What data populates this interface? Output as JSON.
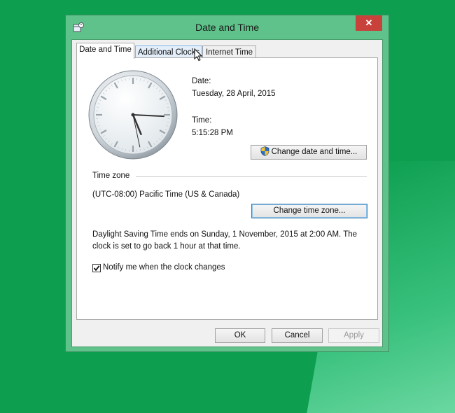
{
  "window": {
    "title": "Date and Time",
    "close_label": "✕"
  },
  "tabs": [
    {
      "label": "Date and Time",
      "active": true
    },
    {
      "label": "Additional Clocks",
      "active": false,
      "hover": true
    },
    {
      "label": "Internet Time",
      "active": false
    }
  ],
  "datetime": {
    "date_label": "Date:",
    "date_value": "Tuesday, 28 April, 2015",
    "time_label": "Time:",
    "time_value": "5:15:28 PM",
    "change_button": "Change date and time..."
  },
  "timezone": {
    "section_label": "Time zone",
    "value": "(UTC-08:00) Pacific Time (US & Canada)",
    "change_button": "Change time zone..."
  },
  "dst": {
    "line1": "Daylight Saving Time ends on Sunday, 1 November, 2015 at 2:00 AM. The",
    "line2": "clock is set to go back 1 hour at that time."
  },
  "notify": {
    "label": "Notify me when the clock changes",
    "checked": true
  },
  "footer": {
    "ok": "OK",
    "cancel": "Cancel",
    "apply": "Apply"
  },
  "clock": {
    "hour": 5,
    "minute": 15,
    "second": 28
  }
}
